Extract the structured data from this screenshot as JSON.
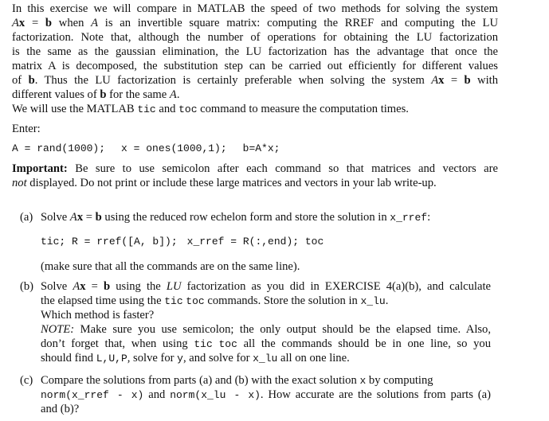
{
  "intro": {
    "lines": [
      [
        "In this exercise we will compare in MATLAB the speed of two methods for solving the system"
      ],
      [
        "Ax = b when A is an invertible square matrix: computing the RREF and computing the LU"
      ],
      [
        "factorization. Note that, although the number of operations for obtaining the LU factorization"
      ],
      [
        "is the same as the gaussian elimination, the LU factorization has the advantage that once the"
      ],
      [
        "matrix A is decomposed, the substitution step can be carried out efficiently for different values"
      ],
      [
        "of b. Thus the LU factorization is certainly preferable when solving the system Ax = b with"
      ],
      [
        "different values of b for the same A."
      ]
    ],
    "l1": "In this exercise we will compare in MATLAB the speed of two methods for solving the system",
    "l2_A": "A",
    "l2_x": "x",
    "l2_eq": " = ",
    "l2_b": "b",
    "l2_rest_a": " when ",
    "l2_A2": "A",
    "l2_rest_b": " is an invertible square matrix: computing the RREF and computing the LU",
    "l3": "factorization. Note that, although the number of operations for obtaining the LU factorization",
    "l4": "is the same as the gaussian elimination, the LU factorization has the advantage that once the",
    "l5": "matrix A is decomposed, the substitution step can be carried out efficiently for different values",
    "l6_a": "of ",
    "l6_b": "b",
    "l6_c": ". Thus the LU factorization is certainly preferable when solving the system ",
    "l6_A": "A",
    "l6_x": "x",
    "l6_eq": " = ",
    "l6_b2": "b",
    "l6_d": " with",
    "l7_a": "different values of ",
    "l7_b": "b",
    "l7_c": " for the same ",
    "l7_A": "A",
    "l7_d": "."
  },
  "tictoc": {
    "a": "We will use the MATLAB ",
    "tic": "tic",
    "b": " and ",
    "toc": "toc",
    "c": " command to measure the computation times."
  },
  "enter_label": "Enter:",
  "enter_code": [
    "A = rand(1000);",
    "x = ones(1000,1);",
    "b=A*x;"
  ],
  "important": {
    "label": "Important:",
    "l1": " Be sure to use semicolon after each command so that matrices and vectors are",
    "l2_it": "not",
    "l2": " displayed. Do not print or include these large matrices and vectors in your lab write-up."
  },
  "items": {
    "a": {
      "label": "(a)",
      "l1_a": "Solve ",
      "A": "A",
      "x": "x",
      "eq": " = ",
      "b": "b",
      "l1_b": " using the reduced row echelon form and store the solution in ",
      "var": "x_rref",
      "l1_c": ":",
      "code": [
        "tic; R = rref([A, b]);",
        "x_rref = R(:,end); toc"
      ],
      "note": "(make sure that all the commands are on the same line)."
    },
    "b": {
      "label": "(b)",
      "l1_a": "Solve ",
      "A": "A",
      "x": "x",
      "eq": " = ",
      "b": "b",
      "l1_b": " using the ",
      "lu": "LU",
      "l1_c": " factorization as you did in EXERCISE 4(a)(b), and calculate",
      "l2_a": "the elapsed time using the ",
      "tic": "tic",
      "toc": "toc",
      "l2_b": " commands. Store the solution in ",
      "var": "x_lu",
      "l2_c": ".",
      "l3": "Which method is faster?",
      "note_label": "NOTE:",
      "l4": " Make sure you use semicolon; the only output should be the elapsed time. Also,",
      "l5_a": "don’t forget that, when using ",
      "l5_tic": "tic",
      "l5_toc": "toc",
      "l5_b": " all the commands should be in one line, so you",
      "l6_a": "should find ",
      "l6_lup": "L,U,P",
      "l6_b": ", solve for ",
      "l6_y": "y",
      "l6_c": ", and solve for ",
      "l6_var": "x_lu",
      "l6_d": " all on one line."
    },
    "c": {
      "label": "(c)",
      "l1_a": "Compare the solutions from parts (a) and (b) with the exact solution ",
      "x": "x",
      "l1_b": " by computing",
      "code1": "norm(x_rref - x)",
      "l2_a": " and ",
      "code2": "norm(x_lu - x)",
      "l2_b": ". How accurate are the solutions from parts (a)",
      "l3": "and (b)?"
    }
  }
}
